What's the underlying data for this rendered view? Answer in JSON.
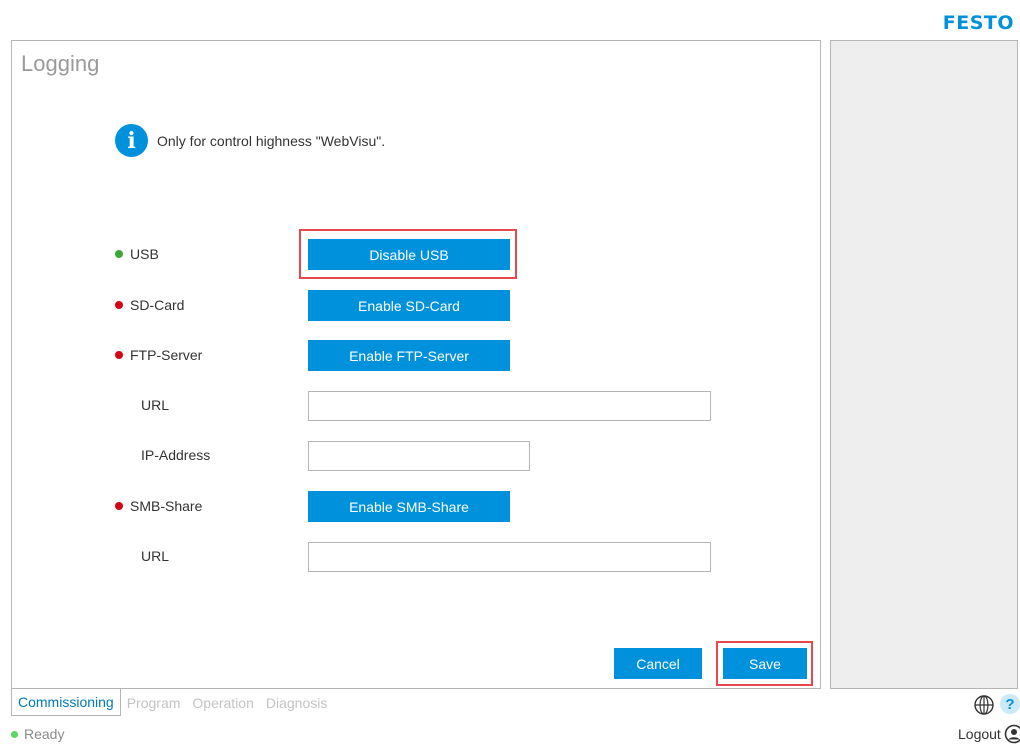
{
  "brand": {
    "logo_text": "FESTO",
    "accent": "#0091dc"
  },
  "page": {
    "title": "Logging"
  },
  "info": {
    "icon": "info-icon",
    "message": "Only for control highness \"WebVisu\"."
  },
  "rows": {
    "usb": {
      "label": "USB",
      "status": "green",
      "button": "Disable USB"
    },
    "sdcard": {
      "label": "SD-Card",
      "status": "red",
      "button": "Enable SD-Card"
    },
    "ftp": {
      "label": "FTP-Server",
      "status": "red",
      "button": "Enable FTP-Server"
    },
    "ftp_url": {
      "label": "URL",
      "value": ""
    },
    "ftp_ip": {
      "label": "IP-Address",
      "value": ""
    },
    "smb": {
      "label": "SMB-Share",
      "status": "red",
      "button": "Enable SMB-Share"
    },
    "smb_url": {
      "label": "URL",
      "value": ""
    }
  },
  "actions": {
    "cancel": "Cancel",
    "save": "Save"
  },
  "tabs": [
    {
      "label": "Commissioning",
      "active": true
    },
    {
      "label": "Program",
      "active": false
    },
    {
      "label": "Operation",
      "active": false
    },
    {
      "label": "Diagnosis",
      "active": false
    }
  ],
  "status": {
    "text": "Ready",
    "color": "#5cd65c"
  },
  "toolbar": {
    "help": "?",
    "logout": "Logout"
  },
  "colors": {
    "highlight": "#e5484d",
    "status_green": "#3aaa35",
    "status_red": "#d50014"
  }
}
